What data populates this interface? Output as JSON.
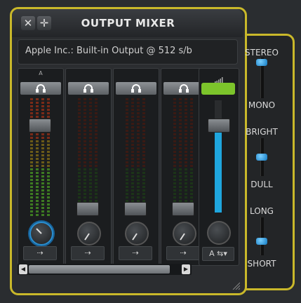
{
  "window": {
    "title": "OUTPUT MIXER",
    "close_icon": "close-icon",
    "move_icon": "move-icon",
    "device_label": "Apple Inc.: Built-in Output @ 512 s/b"
  },
  "channels": [
    {
      "clip_label": "A",
      "route_label": "⇢",
      "fader_level": 0.82,
      "knob_active": true
    },
    {
      "clip_label": "",
      "route_label": "⇢",
      "fader_level": 0.12,
      "knob_active": false
    },
    {
      "clip_label": "",
      "route_label": "⇢",
      "fader_level": 0.12,
      "knob_active": false
    },
    {
      "clip_label": "",
      "route_label": "⇢",
      "fader_level": 0.12,
      "knob_active": false
    }
  ],
  "master": {
    "indicator_color": "#7cc42b",
    "route_label": "A ⇆▾",
    "level": 0.78,
    "fader_level": 0.78
  },
  "side_controls": {
    "width": {
      "top_label": "STEREO",
      "bottom_label": "MONO",
      "value": 0.95
    },
    "tone": {
      "top_label": "BRIGHT",
      "bottom_label": "DULL",
      "value": 0.5
    },
    "decay": {
      "top_label": "LONG",
      "bottom_label": "SHORT",
      "value": 0.35
    }
  },
  "colors": {
    "accent": "#c9b82a",
    "fader_blue": "#1fa6de",
    "meter_green": "#3b8a2a"
  }
}
